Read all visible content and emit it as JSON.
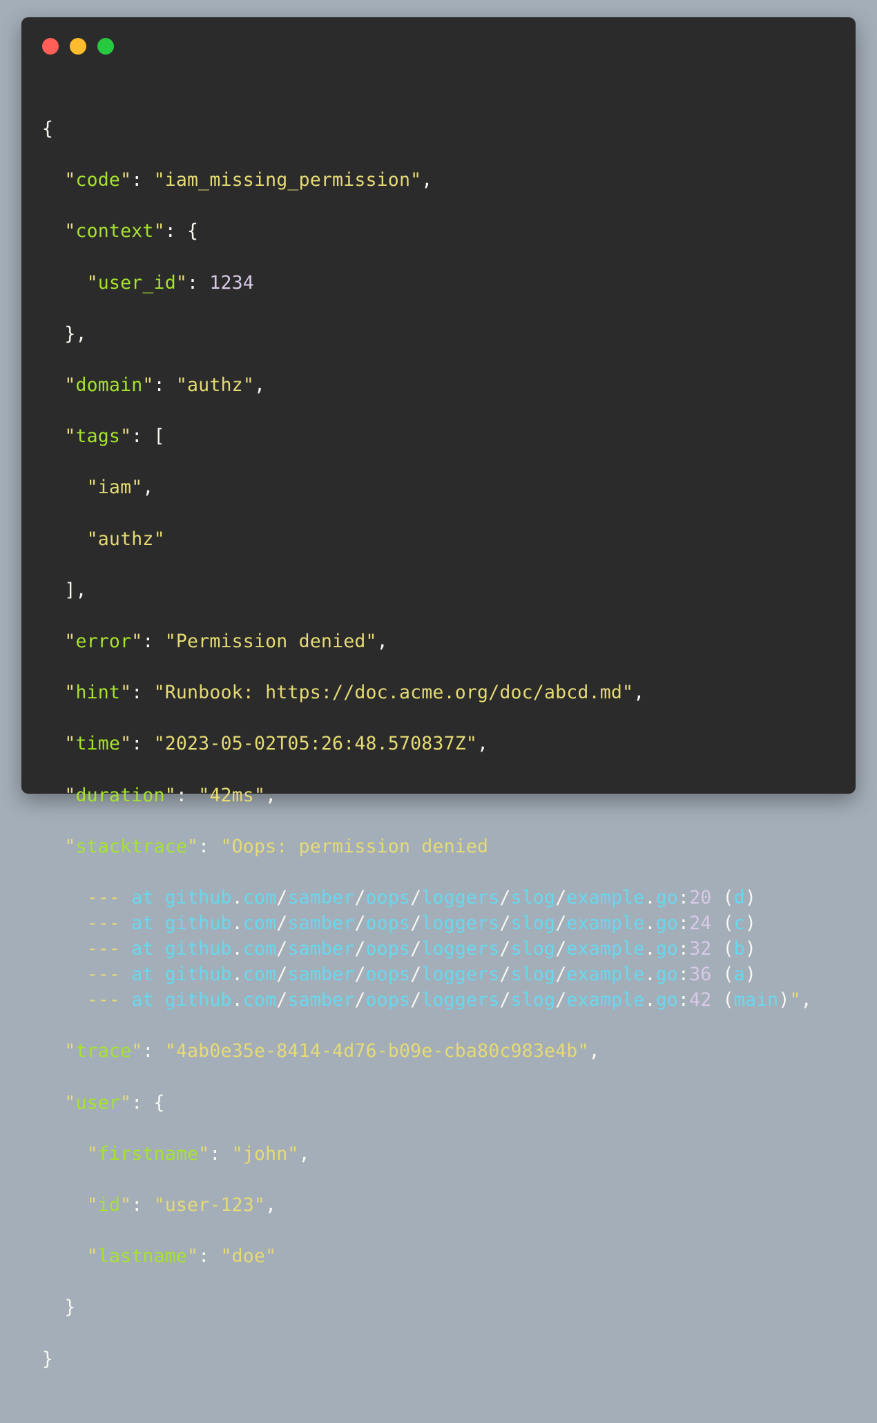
{
  "window": {
    "buttons": [
      {
        "name": "close",
        "color": "#ff5f56"
      },
      {
        "name": "minimize",
        "color": "#ffbd2e"
      },
      {
        "name": "maximize",
        "color": "#27c93f"
      }
    ]
  },
  "code": {
    "code_value": "iam_missing_permission",
    "context_user_id": "1234",
    "domain": "authz",
    "tags": [
      "iam",
      "authz"
    ],
    "error": "Permission denied",
    "hint": "Runbook: https://doc.acme.org/doc/abcd.md",
    "time": "2023-05-02T05:26:48.570837Z",
    "duration": "42ms",
    "stacktrace_head": "Oops: permission denied",
    "stack_frames": [
      {
        "line": "20",
        "func": "d"
      },
      {
        "line": "24",
        "func": "c"
      },
      {
        "line": "32",
        "func": "b"
      },
      {
        "line": "36",
        "func": "a"
      },
      {
        "line": "42",
        "func": "main"
      }
    ],
    "stack_path": {
      "host1": "github",
      "host2": "com",
      "p1": "samber",
      "p2": "oops",
      "p3": "loggers",
      "p4": "slog",
      "file": "example",
      "ext": "go"
    },
    "trace": "4ab0e35e-8414-4d76-b09e-cba80c983e4b",
    "user": {
      "firstname": "john",
      "id": "user-123",
      "lastname": "doe"
    }
  }
}
